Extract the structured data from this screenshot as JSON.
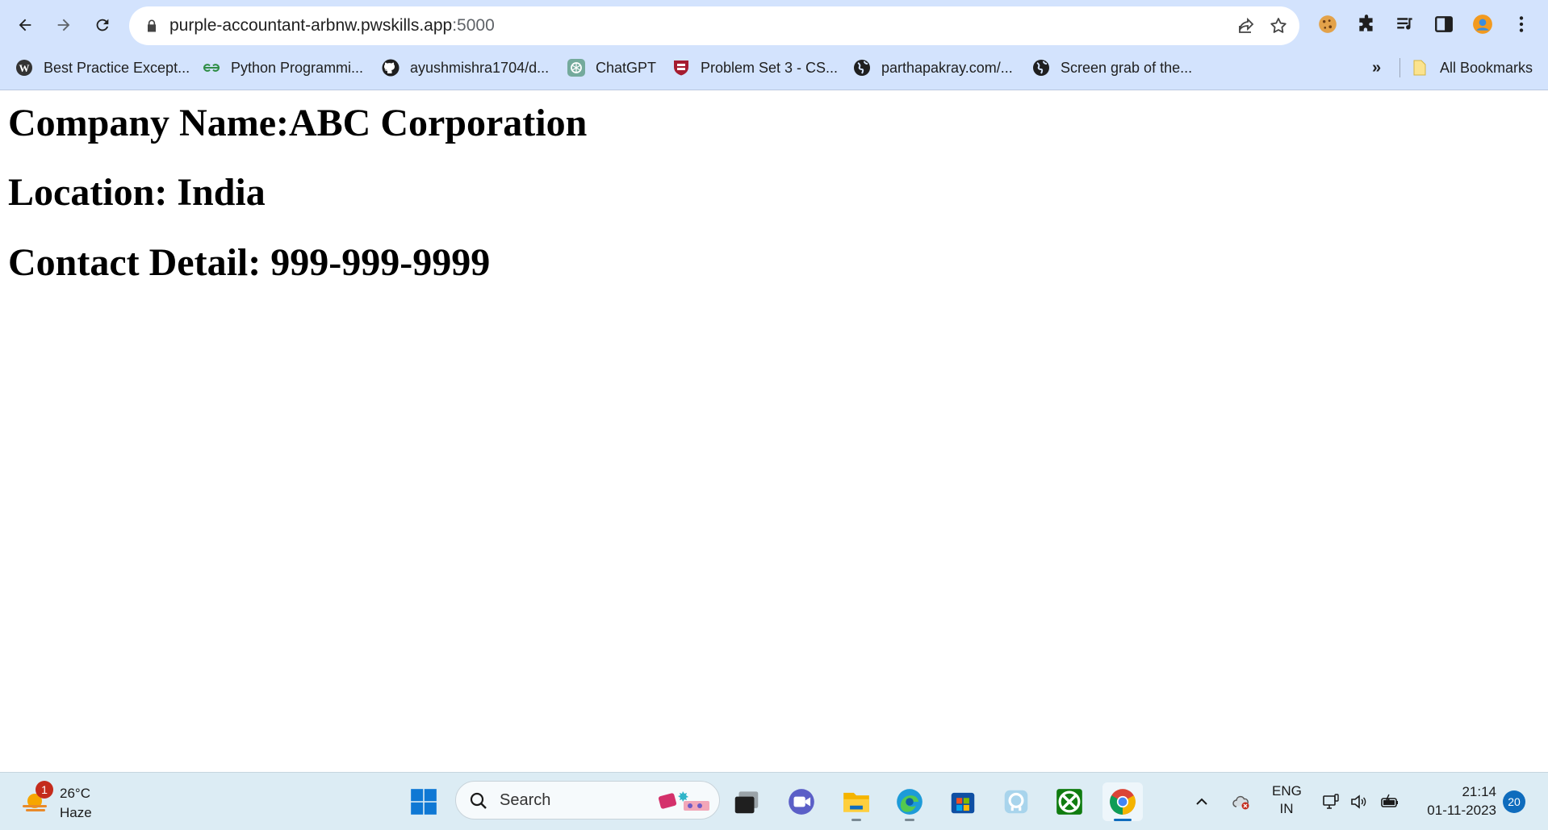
{
  "browser": {
    "url_host": "purple-accountant-arbnw.pwskills.app",
    "url_port": ":5000",
    "bookmarks": [
      {
        "label": "Best Practice Except...",
        "icon": "wordpress-icon"
      },
      {
        "label": "Python Programmi...",
        "icon": "geeksforgeeks-icon"
      },
      {
        "label": "ayushmishra1704/d...",
        "icon": "github-icon"
      },
      {
        "label": "ChatGPT",
        "icon": "chatgpt-icon"
      },
      {
        "label": "Problem Set 3 - CS...",
        "icon": "harvard-shield-icon"
      },
      {
        "label": "parthapakray.com/...",
        "icon": "globe-icon"
      },
      {
        "label": "Screen grab of the...",
        "icon": "globe-icon"
      }
    ],
    "bookmarks_overflow": "»",
    "all_bookmarks_label": "All Bookmarks"
  },
  "page": {
    "company": "Company Name:ABC Corporation",
    "location": "Location: India",
    "contact": "Contact Detail: 999-999-9999"
  },
  "taskbar": {
    "weather": {
      "badge": "1",
      "temp": "26°C",
      "condition": "Haze"
    },
    "search_placeholder": "Search",
    "lang_top": "ENG",
    "lang_bottom": "IN",
    "time": "21:14",
    "date": "01-11-2023",
    "notifications": "20"
  },
  "colors": {
    "chrome_bg": "#d3e3fd",
    "taskbar_bg": "#dcecf4",
    "accent": "#0f6cbd"
  }
}
